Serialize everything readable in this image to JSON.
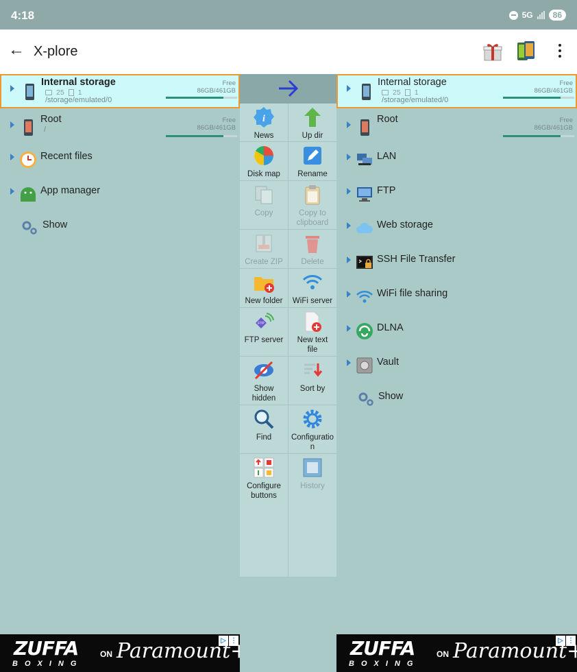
{
  "status_bar": {
    "time": "4:18",
    "network": "5G",
    "battery": "86"
  },
  "app_bar": {
    "title": "X-plore"
  },
  "left_pane": {
    "internal_storage": {
      "name": "Internal storage",
      "folders": "25",
      "files": "1",
      "path": "/storage/emulated/0",
      "free_label": "Free",
      "capacity": "86GB/461GB",
      "used_fraction": 0.81
    },
    "root": {
      "name": "Root",
      "path": "/",
      "free_label": "Free",
      "capacity": "86GB/461GB",
      "used_fraction": 0.81
    },
    "items": [
      {
        "label": "Recent files",
        "icon": "clock-icon"
      },
      {
        "label": "App manager",
        "icon": "android-icon"
      },
      {
        "label": "Show",
        "icon": "gears-icon"
      }
    ]
  },
  "right_pane": {
    "internal_storage": {
      "name": "Internal storage",
      "folders": "25",
      "files": "1",
      "path": "/storage/emulated/0",
      "free_label": "Free",
      "capacity": "86GB/461GB",
      "used_fraction": 0.81
    },
    "root": {
      "name": "Root",
      "free_label": "Free",
      "capacity": "86GB/461GB",
      "used_fraction": 0.81
    },
    "items": [
      {
        "label": "LAN",
        "icon": "lan-icon"
      },
      {
        "label": "FTP",
        "icon": "ftp-icon"
      },
      {
        "label": "Web storage",
        "icon": "cloud-icon"
      },
      {
        "label": "SSH File Transfer",
        "icon": "ssh-icon"
      },
      {
        "label": "WiFi file sharing",
        "icon": "wifi-icon"
      },
      {
        "label": "DLNA",
        "icon": "dlna-icon"
      },
      {
        "label": "Vault",
        "icon": "vault-icon"
      },
      {
        "label": "Show",
        "icon": "gears-icon"
      }
    ]
  },
  "toolbar": {
    "news": "News",
    "up_dir": "Up dir",
    "disk_map": "Disk map",
    "rename": "Rename",
    "copy": "Copy",
    "copy_clipboard_1": "Copy to",
    "copy_clipboard_2": "clipboard",
    "create_zip": "Create ZIP",
    "delete": "Delete",
    "new_folder": "New folder",
    "wifi_server": "WiFi server",
    "ftp_server": "FTP server",
    "new_text_1": "New text",
    "new_text_2": "file",
    "show_hidden_1": "Show",
    "show_hidden_2": "hidden",
    "sort_by": "Sort by",
    "find": "Find",
    "config_1": "Configuratio",
    "config_2": "n",
    "configure_buttons_1": "Configure",
    "configure_buttons_2": "buttons",
    "history": "History"
  },
  "ads": {
    "brand_1": "ZUFFA",
    "brand_2": "BOXING",
    "on": "ON",
    "network": "Paramount+"
  },
  "colors": {
    "pane_bg": "#aacac8",
    "selected_bg": "#ccfafb",
    "selected_border": "#ec9a2f",
    "usage_bar": "#2f8e7a",
    "accent_blue": "#3a82c4"
  }
}
